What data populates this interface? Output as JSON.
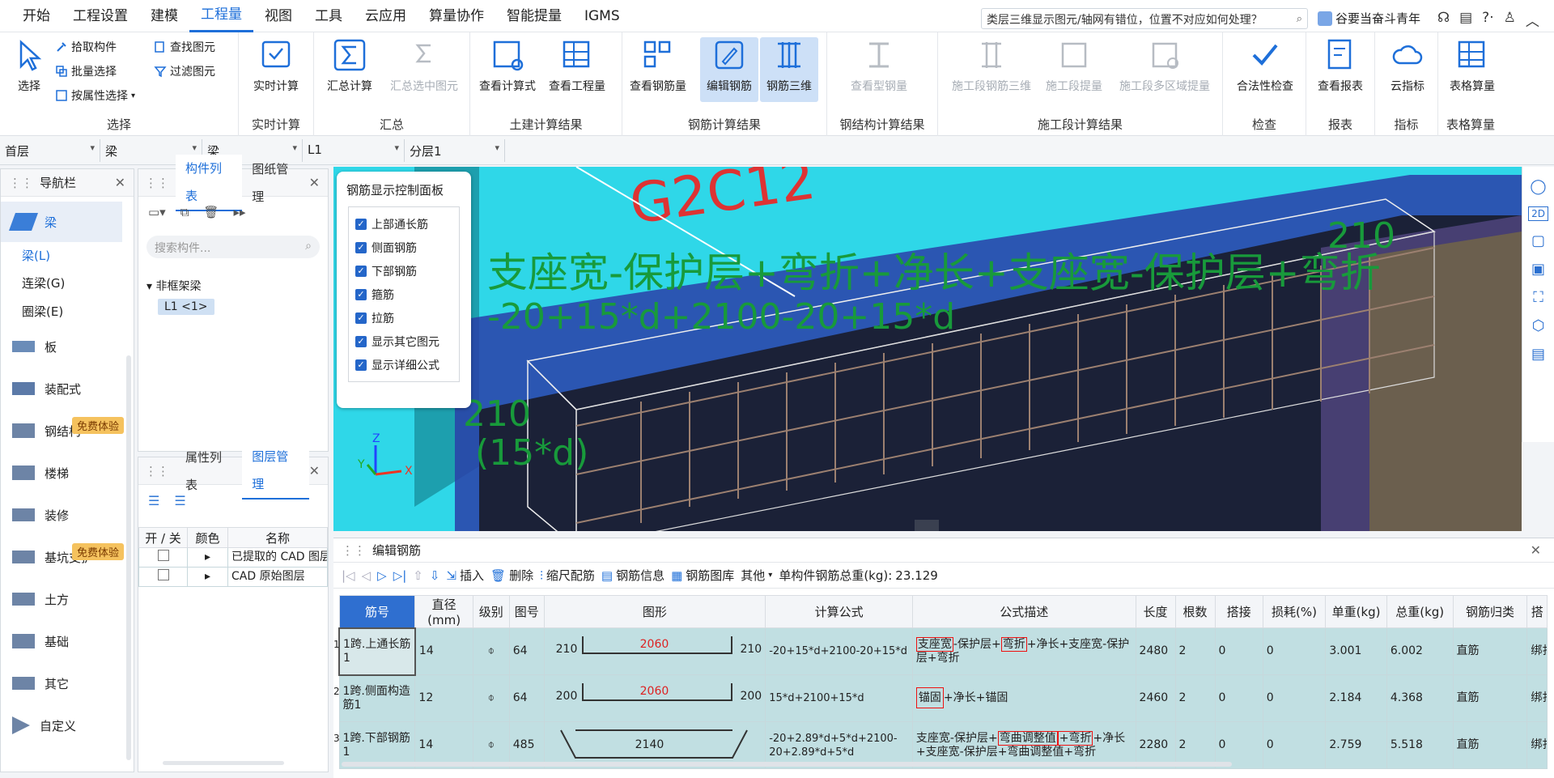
{
  "menu": {
    "items": [
      "开始",
      "工程设置",
      "建模",
      "工程量",
      "视图",
      "工具",
      "云应用",
      "算量协作",
      "智能提量",
      "IGMS"
    ],
    "active_index": 3,
    "help_question": "类层三维显示图元/轴网有错位，位置不对应如何处理？",
    "username": "谷要当奋斗青年"
  },
  "ribbon": {
    "select_group": {
      "label": "选择",
      "select": "选择",
      "pick": "拾取构件",
      "batch": "批量选择",
      "by_attr": "按属性选择",
      "find": "查找图元",
      "filter": "过滤图元"
    },
    "realtime_group": {
      "label": "实时计算",
      "btn": "实时计算"
    },
    "summary_group": {
      "label": "汇总",
      "calc": "汇总计算",
      "calc_sel": "汇总选中图元"
    },
    "civil_group": {
      "label": "土建计算结果",
      "formula": "查看计算式",
      "quantity": "查看工程量"
    },
    "rebar_group": {
      "label": "钢筋计算结果",
      "view": "查看钢筋量",
      "edit": "编辑钢筋",
      "rebar3d": "钢筋三维"
    },
    "steel_group": {
      "label": "钢结构计算结果",
      "view": "查看型钢量"
    },
    "stage_group": {
      "label": "施工段计算结果",
      "rebar3d": "施工段钢筋三维",
      "quantity": "施工段提量",
      "multi": "施工段多区域提量"
    },
    "check_group": {
      "label": "检查",
      "btn": "合法性检查"
    },
    "report_group": {
      "label": "报表",
      "btn": "查看报表"
    },
    "index_group": {
      "label": "指标",
      "btn": "云指标"
    },
    "table_group": {
      "label": "表格算量",
      "btn": "表格算量"
    }
  },
  "combos": [
    "首层",
    "梁",
    "梁",
    "L1",
    "分层1"
  ],
  "nav": {
    "title": "导航栏",
    "category": "梁",
    "sub_items": [
      "梁(L)",
      "连梁(G)",
      "圈梁(E)"
    ],
    "items": [
      "板",
      "装配式",
      "钢结构",
      "楼梯",
      "装修",
      "基坑支护",
      "土方",
      "基础",
      "其它",
      "自定义"
    ],
    "badge": "免费体验"
  },
  "component_panel": {
    "tab1": "构件列表",
    "tab2": "图纸管理",
    "search_placeholder": "搜索构件...",
    "tree_group": "非框架梁",
    "tree_item": "L1 <1>"
  },
  "layer_panel": {
    "tab1": "属性列表",
    "tab2": "图层管理",
    "col_onoff": "开 / 关",
    "col_color": "颜色",
    "col_name": "名称",
    "rows": [
      "已提取的 CAD 图层",
      "CAD 原始图层"
    ]
  },
  "control_panel": {
    "title": "钢筋显示控制面板",
    "items": [
      "上部通长筋",
      "侧面钢筋",
      "下部钢筋",
      "箍筋",
      "拉筋",
      "显示其它图元",
      "显示详细公式"
    ]
  },
  "viewport": {
    "label_main": "支座宽-保护层+弯折+净长+支座宽-保护层+弯折",
    "label_formula": "-20+15*d+2100-20+15*d",
    "label_len": "210",
    "label_15d": "(15*d)",
    "label_top_right": "210",
    "label_bg": "G2C12"
  },
  "editor": {
    "title": "编辑钢筋",
    "insert": "插入",
    "delete": "删除",
    "scale": "缩尺配筋",
    "info": "钢筋信息",
    "library": "钢筋图库",
    "other": "其他",
    "total_label": "单构件钢筋总重(kg):",
    "total_value": "23.129",
    "headers": [
      "筋号",
      "直径(mm)",
      "级别",
      "图号",
      "图形",
      "计算公式",
      "公式描述",
      "长度",
      "根数",
      "搭接",
      "损耗(%)",
      "单重(kg)",
      "总重(kg)",
      "钢筋归类",
      "搭"
    ],
    "rows": [
      {
        "num": "1",
        "name": "1跨.上通长筋1",
        "dia": "14",
        "grade": "⌽",
        "fig": "64",
        "shape_left": "210",
        "shape_mid": "2060",
        "shape_right": "210",
        "formula": "-20+15*d+2100-20+15*d",
        "desc_a": "支座宽",
        "desc_b": "-保护层+",
        "desc_c": "弯折",
        "desc_d": "+净长+支座宽-保护层+弯折",
        "len": "2480",
        "count": "2",
        "lap": "0",
        "loss": "0",
        "unit_w": "3.001",
        "total_w": "6.002",
        "cat": "直筋",
        "lap2": "绑扎"
      },
      {
        "num": "2",
        "name": "1跨.侧面构造筋1",
        "dia": "12",
        "grade": "⌽",
        "fig": "64",
        "shape_left": "200",
        "shape_mid": "2060",
        "shape_right": "200",
        "formula": "15*d+2100+15*d",
        "desc_a": "锚固",
        "desc_d": "+净长+锚固",
        "len": "2460",
        "count": "2",
        "lap": "0",
        "loss": "0",
        "unit_w": "2.184",
        "total_w": "4.368",
        "cat": "直筋",
        "lap2": "绑扎"
      },
      {
        "num": "3",
        "name": "1跨.下部钢筋1",
        "dia": "14",
        "grade": "⌽",
        "fig": "485",
        "shape_mid": "2140",
        "formula": "-20+2.89*d+5*d+2100-20+2.89*d+5*d",
        "desc_a": "支座宽-保护层+",
        "desc_b": "弯曲调整值",
        "desc_c": "+弯折",
        "desc_d": "+净长+支座宽-保护层+弯曲调整值+弯折",
        "len": "2280",
        "count": "2",
        "lap": "0",
        "loss": "0",
        "unit_w": "2.759",
        "total_w": "5.518",
        "cat": "直筋",
        "lap2": "绑扎"
      }
    ]
  }
}
